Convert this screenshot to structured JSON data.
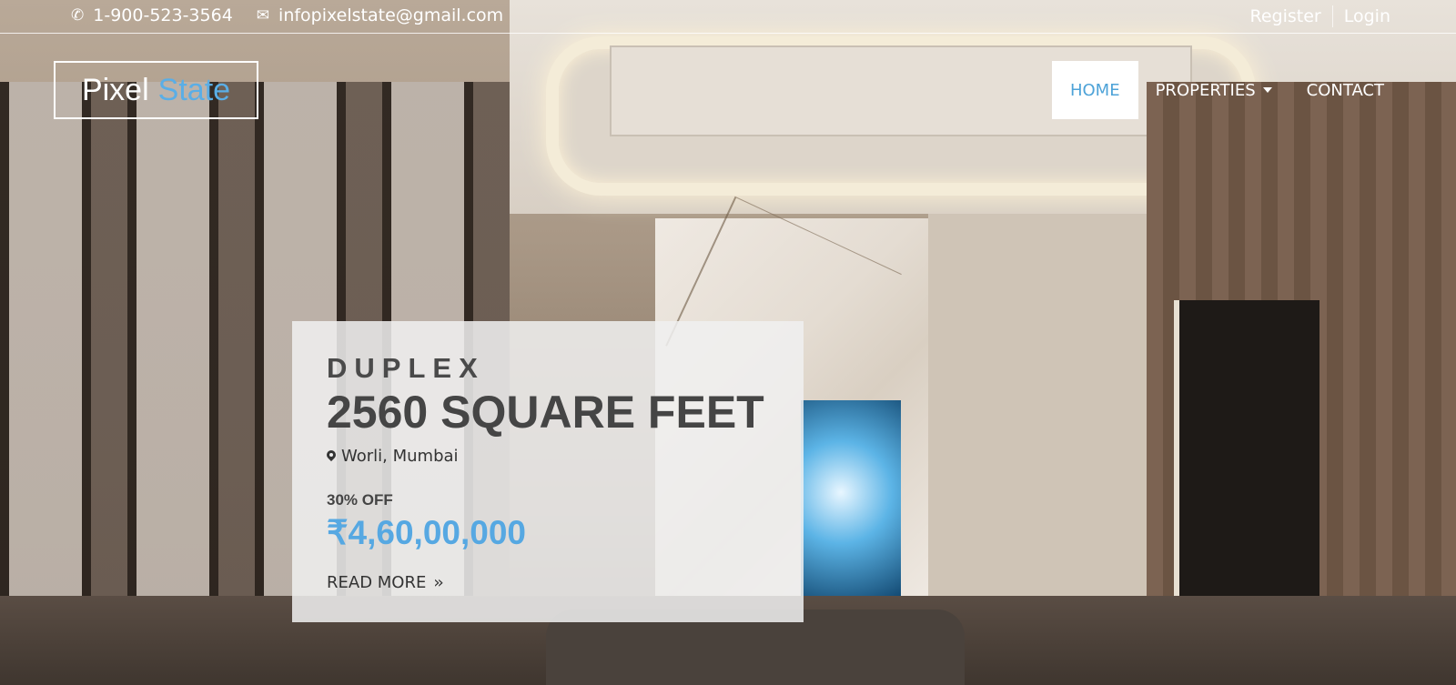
{
  "topbar": {
    "phone": "1-900-523-3564",
    "email": "infopixelstate@gmail.com",
    "register": "Register",
    "login": "Login"
  },
  "brand": {
    "word1": "Pixel",
    "word2": "State",
    "accent": "#5aaee6"
  },
  "nav": {
    "home": "HOME",
    "properties": "PROPERTIES",
    "contact": "CONTACT",
    "active_color": "#4ea3d8"
  },
  "listing": {
    "type": "DUPLEX",
    "size": "2560 SQUARE FEET",
    "location": "Worli, Mumbai",
    "discount": "30% OFF",
    "price": "₹4,60,00,000",
    "read_more": "READ MORE",
    "price_color": "#56a8e2"
  },
  "icons": {
    "phone": "phone-icon",
    "email": "envelope-icon",
    "location": "map-marker-icon",
    "caret": "caret-down-icon",
    "read_more": "double-chevron-right-icon"
  }
}
